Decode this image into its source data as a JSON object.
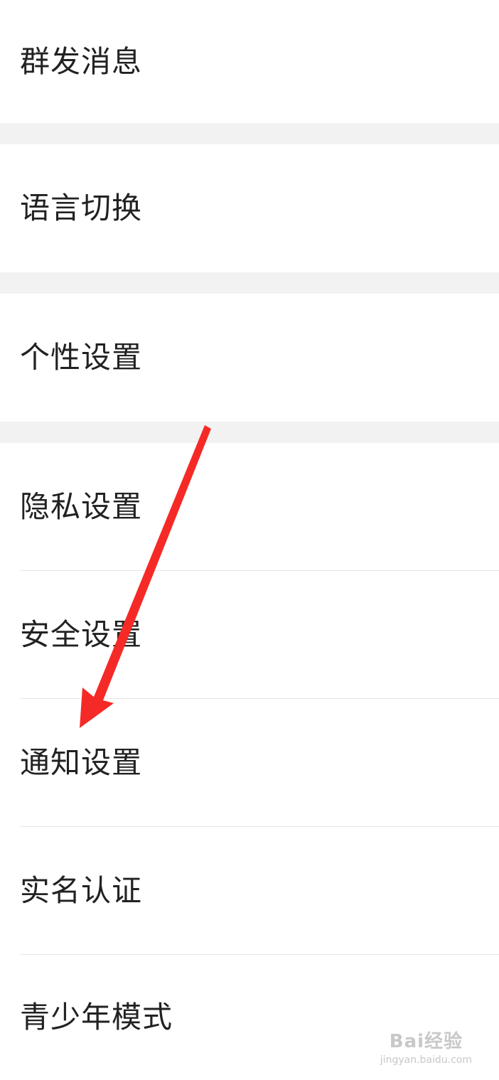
{
  "settings": {
    "group1": {
      "item1": "群发消息"
    },
    "group2": {
      "item1": "语言切换"
    },
    "group3": {
      "item1": "个性设置"
    },
    "group4": {
      "item1": "隐私设置",
      "item2": "安全设置",
      "item3": "通知设置",
      "item4": "实名认证",
      "item5": "青少年模式"
    }
  },
  "annotation": {
    "arrow_color": "#f52a26"
  },
  "watermark": {
    "brand": "Bai经验",
    "site": "jingyan.baidu.com"
  },
  "colors": {
    "background": "#ffffff",
    "group_gap": "#f2f2f2",
    "text": "#222222",
    "divider": "#e6e6e6"
  }
}
